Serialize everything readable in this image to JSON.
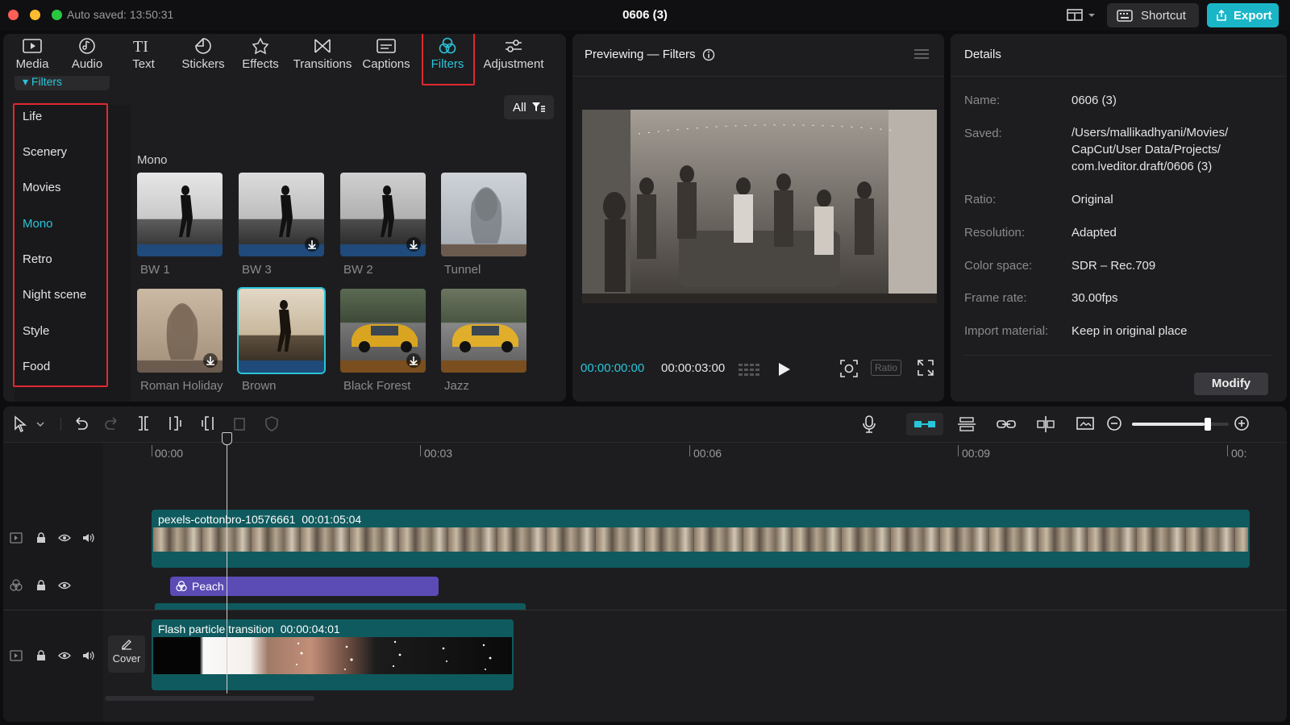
{
  "titlebar": {
    "autosave": "Auto saved: 13:50:31",
    "project_title": "0606 (3)",
    "shortcut_label": "Shortcut",
    "export_label": "Export"
  },
  "tabs": [
    {
      "label": "Media",
      "icon": "media-icon"
    },
    {
      "label": "Audio",
      "icon": "audio-icon"
    },
    {
      "label": "Text",
      "icon": "text-icon"
    },
    {
      "label": "Stickers",
      "icon": "stickers-icon"
    },
    {
      "label": "Effects",
      "icon": "effects-icon"
    },
    {
      "label": "Transitions",
      "icon": "transitions-icon"
    },
    {
      "label": "Captions",
      "icon": "captions-icon"
    },
    {
      "label": "Filters",
      "icon": "filters-icon",
      "active": true
    },
    {
      "label": "Adjustment",
      "icon": "adjustment-icon"
    }
  ],
  "sidebar": {
    "crumb": "▾ Filters",
    "categories": [
      "Life",
      "Scenery",
      "Movies",
      "Mono",
      "Retro",
      "Night scene",
      "Style",
      "Food"
    ],
    "active": "Mono"
  },
  "filter_panel": {
    "all_label": "All",
    "section_label": "Mono",
    "filters": [
      {
        "name": "BW 1"
      },
      {
        "name": "BW 3"
      },
      {
        "name": "BW 2"
      },
      {
        "name": "Tunnel"
      },
      {
        "name": "Roman Holiday"
      },
      {
        "name": "Brown",
        "selected": true
      },
      {
        "name": "Black Forest"
      },
      {
        "name": "Jazz"
      }
    ]
  },
  "preview": {
    "title": "Previewing — Filters",
    "current_time": "00:00:00:00",
    "total_time": "00:00:03:00",
    "ratio_label": "Ratio"
  },
  "details": {
    "title": "Details",
    "rows": [
      {
        "key": "Name:",
        "value": "0606 (3)"
      },
      {
        "key": "Saved:",
        "value": "/Users/mallikadhyani/Movies/ CapCut/User Data/Projects/ com.lveditor.draft/0606 (3)"
      },
      {
        "key": "Ratio:",
        "value": "Original"
      },
      {
        "key": "Resolution:",
        "value": "Adapted"
      },
      {
        "key": "Color space:",
        "value": "SDR – Rec.709"
      },
      {
        "key": "Frame rate:",
        "value": "30.00fps"
      },
      {
        "key": "Import material:",
        "value": "Keep in original place"
      }
    ],
    "modify_label": "Modify"
  },
  "timeline": {
    "ruler": [
      "00:00",
      "00:03",
      "00:06",
      "00:09",
      "00:"
    ],
    "main_clip": {
      "name": "pexels-cottonbro-10576661",
      "duration": "00:01:05:04"
    },
    "filter_clip": {
      "name": "Peach"
    },
    "transition_clip": {
      "name": "Flash particle transition",
      "duration": "00:00:04:01"
    },
    "cover_label": "Cover",
    "zoom_level": 0.78
  },
  "colors": {
    "accent": "#29c5d8",
    "highlight_box": "#e0282e",
    "filter_clip": "#5b4bb5",
    "clip_bg": "#0f5a5e"
  }
}
